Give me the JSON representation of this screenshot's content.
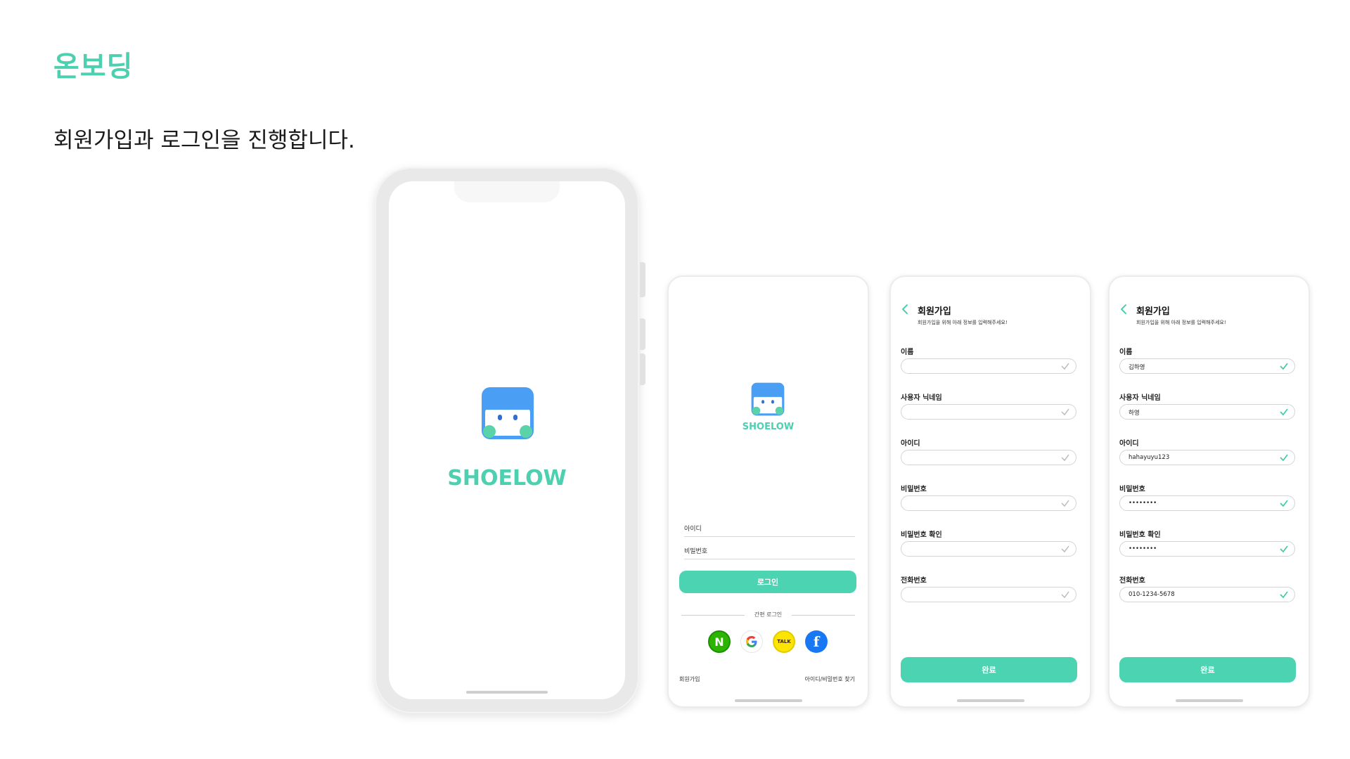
{
  "page": {
    "title": "온보딩",
    "description": "회원가입과 로그인을 진행합니다."
  },
  "colors": {
    "accent": "#4cd0b0",
    "button": "#4cd3b1",
    "logo_blue": "#4a9ff5",
    "naver": "#2db400",
    "kakao": "#fee500",
    "facebook": "#1877f2"
  },
  "splash": {
    "brand": "SHOELOW"
  },
  "login": {
    "brand": "SHOELOW",
    "id_placeholder": "아이디",
    "password_placeholder": "비밀번호",
    "login_button": "로그인",
    "easy_login_label": "간편 로그인",
    "social": [
      {
        "name": "naver-icon",
        "glyph": "N"
      },
      {
        "name": "google-icon",
        "glyph": "G"
      },
      {
        "name": "kakaotalk-icon",
        "glyph": "TALK"
      },
      {
        "name": "facebook-icon",
        "glyph": "f"
      }
    ],
    "signup_link": "회원가입",
    "find_account_link": "아이디/비밀번호 찾기"
  },
  "signup_empty": {
    "title": "회원가입",
    "subtitle": "회원가입을 위해 아래 정보를 입력해주세요!",
    "fields": [
      {
        "label": "이름",
        "value": ""
      },
      {
        "label": "사용자 닉네임",
        "value": ""
      },
      {
        "label": "아이디",
        "value": ""
      },
      {
        "label": "비밀번호",
        "value": ""
      },
      {
        "label": "비밀번호 확인",
        "value": ""
      },
      {
        "label": "전화번호",
        "value": ""
      }
    ],
    "done_button": "완료"
  },
  "signup_filled": {
    "title": "회원가입",
    "subtitle": "회원가입을 위해 아래 정보를 입력해주세요!",
    "fields": [
      {
        "label": "이름",
        "value": "김하영"
      },
      {
        "label": "사용자 닉네임",
        "value": "하영"
      },
      {
        "label": "아이디",
        "value": "hahayuyu123"
      },
      {
        "label": "비밀번호",
        "value": "••••••••"
      },
      {
        "label": "비밀번호 확인",
        "value": "••••••••"
      },
      {
        "label": "전화번호",
        "value": "010-1234-5678"
      }
    ],
    "done_button": "완료"
  }
}
